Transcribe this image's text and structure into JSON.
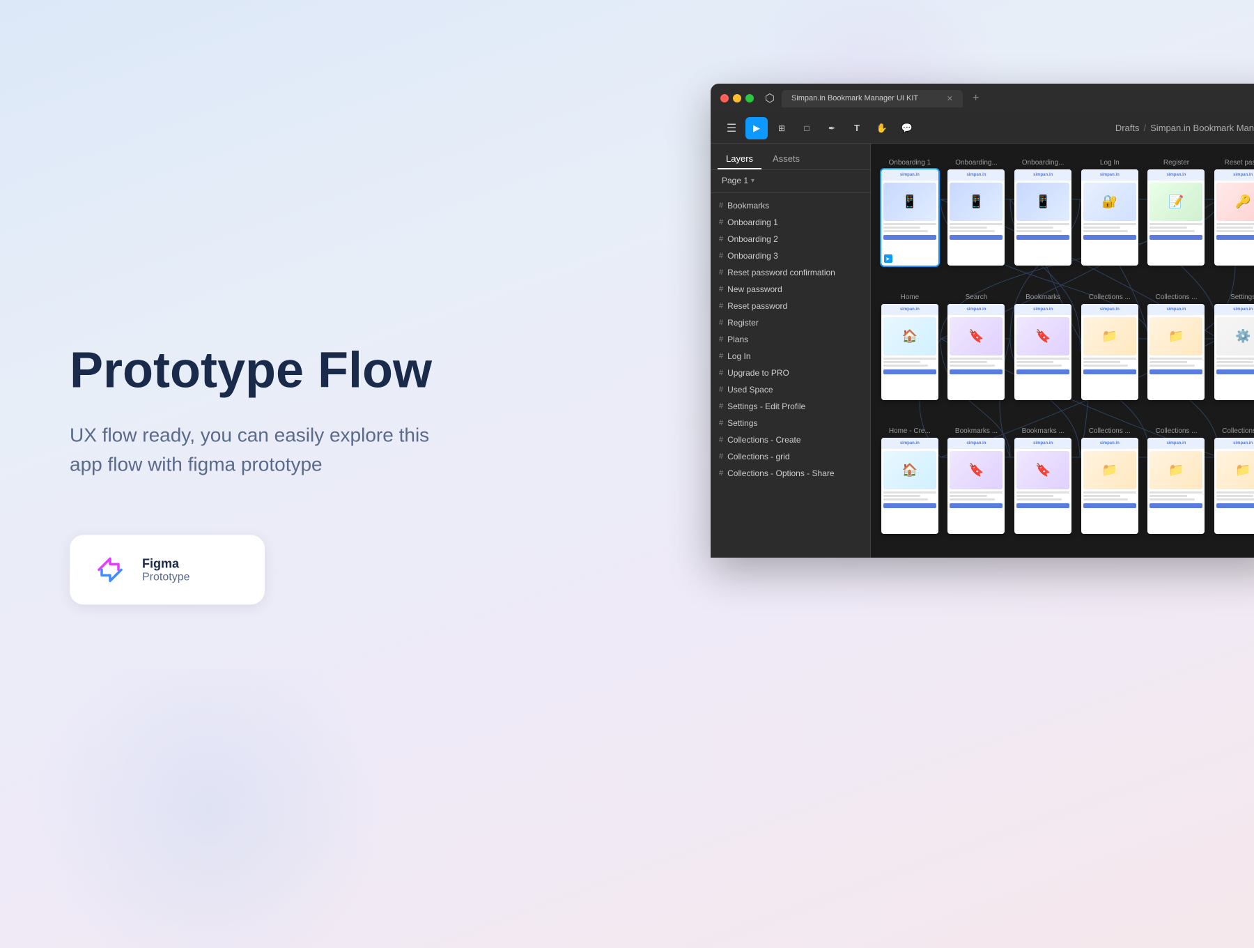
{
  "page": {
    "title": "Prototype Flow",
    "subtitle": "UX flow ready, you can easily explore this app flow with figma prototype"
  },
  "badge": {
    "title": "Figma",
    "subtitle": "Prototype"
  },
  "browser": {
    "tab_title": "Simpan.in Bookmark Manager UI KIT",
    "breadcrumb": {
      "drafts": "Drafts",
      "separator": "/",
      "project": "Simpan.in Bookmark Manager"
    }
  },
  "figma": {
    "panel_tabs": [
      {
        "label": "Layers",
        "active": true
      },
      {
        "label": "Assets",
        "active": false
      }
    ],
    "page_selector": "Page 1",
    "layers": [
      "Bookmarks",
      "Onboarding 1",
      "Onboarding 2",
      "Onboarding 3",
      "Reset password confirmation",
      "New password",
      "Reset password",
      "Register",
      "Plans",
      "Log In",
      "Upgrade to PRO",
      "Used Space",
      "Settings - Edit Profile",
      "Settings",
      "Collections - Create",
      "Collections - grid",
      "Collections - Options - Share"
    ],
    "frames": [
      {
        "label": "Onboarding 1",
        "type": "onboarding",
        "active": true
      },
      {
        "label": "Onboarding...",
        "type": "onboarding",
        "active": false
      },
      {
        "label": "Onboarding...",
        "type": "onboarding",
        "active": false
      },
      {
        "label": "Log In",
        "type": "login",
        "active": false
      },
      {
        "label": "Register",
        "type": "register",
        "active": false
      },
      {
        "label": "Reset pas...",
        "type": "reset",
        "active": false
      },
      {
        "label": "Home",
        "type": "home",
        "active": false
      },
      {
        "label": "Search",
        "type": "bookmarks",
        "active": false
      },
      {
        "label": "Bookmarks",
        "type": "bookmarks",
        "active": false
      },
      {
        "label": "Collections ...",
        "type": "collections",
        "active": false
      },
      {
        "label": "Collections ...",
        "type": "collections",
        "active": false
      },
      {
        "label": "Settings",
        "type": "settings",
        "active": false
      },
      {
        "label": "Home - Cre...",
        "type": "home",
        "active": false
      },
      {
        "label": "Bookmarks ...",
        "type": "bookmarks",
        "active": false
      },
      {
        "label": "Bookmarks ...",
        "type": "bookmarks",
        "active": false
      },
      {
        "label": "Collections ...",
        "type": "collections",
        "active": false
      },
      {
        "label": "Collections ...",
        "type": "collections",
        "active": false
      },
      {
        "label": "Collections ...",
        "type": "collections",
        "active": false
      }
    ]
  }
}
